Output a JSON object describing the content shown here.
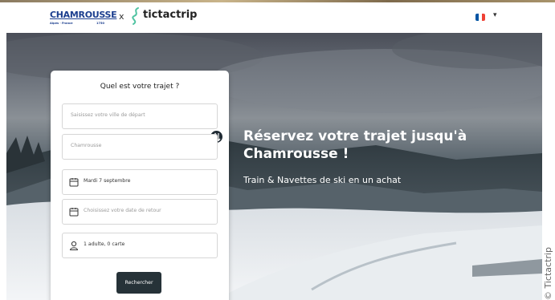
{
  "brand": {
    "chamrousse": "CHAMROUSSE",
    "chamrousse_sub": "Alpes · France",
    "chamrousse_alt": "1750",
    "separator": "x",
    "partner": "tictactrip"
  },
  "language": {
    "flag": "fr",
    "flag_colors": [
      "#0055A4",
      "#FFFFFF",
      "#EF4135"
    ]
  },
  "hero": {
    "title": "Réservez votre trajet jusqu'à Chamrousse !",
    "subtitle": "Train & Navettes de ski en un achat"
  },
  "form": {
    "title": "Quel est votre trajet ?",
    "departure_placeholder": "Saisissez votre ville de départ",
    "destination_value": "Chamrousse",
    "outbound_date": "Mardi 7 septembre",
    "return_placeholder": "Choisissez votre date de retour",
    "passengers": "1 adulte, 0 carte",
    "search_label": "Rechercher"
  },
  "credit": "© Tictactrip",
  "colors": {
    "brand_blue": "#1c3f8f",
    "button_dark": "#263238",
    "tictactrip_green": "#4fc3a1"
  }
}
